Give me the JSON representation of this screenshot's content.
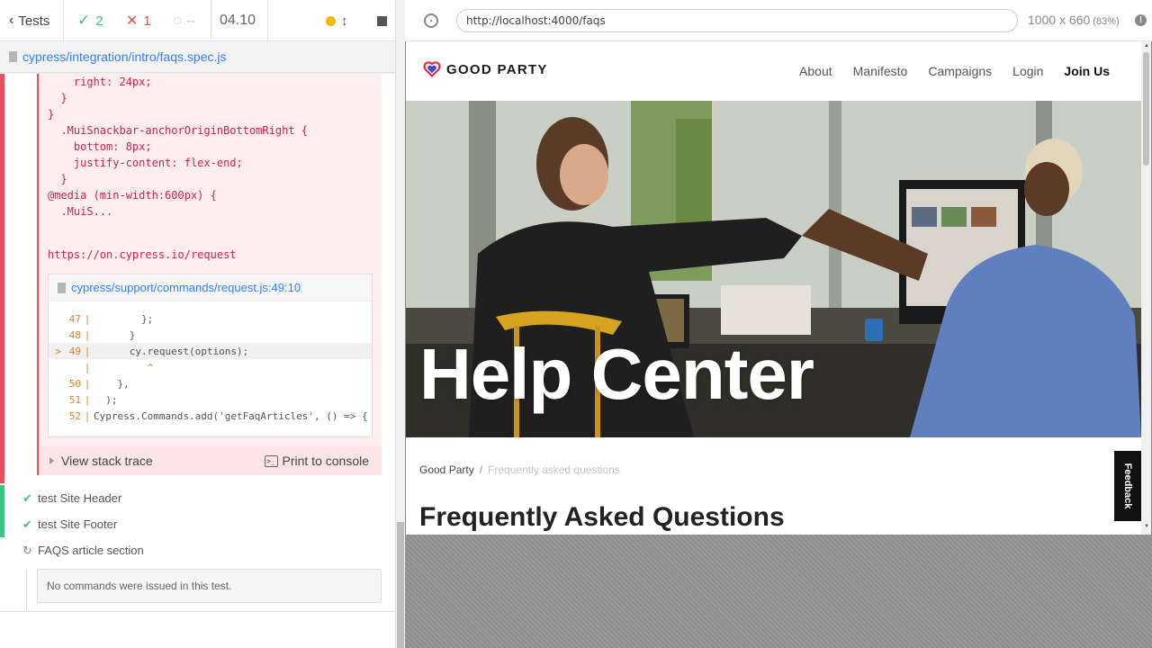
{
  "reporter": {
    "back_label": "Tests",
    "passed": "2",
    "failed": "1",
    "pending": "--",
    "duration": "04.10",
    "spec_path": "cypress/integration/intro/faqs.spec.js",
    "error": {
      "css_snippet": "    right: 24px;\n  }\n}\n  .MuiSnackbar-anchorOriginBottomRight {\n    bottom: 8px;\n    justify-content: flex-end;\n  }\n@media (min-width:600px) {\n  .MuiS...",
      "link": "https://on.cypress.io/request",
      "frame_file": "cypress/support/commands/request.js:49:10",
      "code_lines": [
        {
          "marker": "",
          "num": "47",
          "code": "        };"
        },
        {
          "marker": "",
          "num": "48",
          "code": "      }"
        },
        {
          "marker": ">",
          "num": "49",
          "code": "      cy.request(options);"
        },
        {
          "marker": "",
          "num": "",
          "code": "         ^"
        },
        {
          "marker": "",
          "num": "50",
          "code": "    },"
        },
        {
          "marker": "",
          "num": "51",
          "code": "  );"
        },
        {
          "marker": "",
          "num": "52",
          "code": "Cypress.Commands.add('getFaqArticles', () => {"
        }
      ],
      "view_stack_trace": "View stack trace",
      "print_to_console": "Print to console"
    },
    "tests": [
      {
        "title": "test Site Header",
        "state": "passed"
      },
      {
        "title": "test Site Footer",
        "state": "passed"
      },
      {
        "title": "FAQS article section",
        "state": "running"
      }
    ],
    "no_commands": "No commands were issued in this test."
  },
  "browser": {
    "url": "http://localhost:4000/faqs",
    "viewport": "1000 x 660",
    "scale": "(83%)"
  },
  "site": {
    "brand": "GOOD PARTY",
    "nav": [
      "About",
      "Manifesto",
      "Campaigns",
      "Login",
      "Join Us"
    ],
    "hero_title": "Help Center",
    "breadcrumb_home": "Good Party",
    "breadcrumb_current": "Frequently asked questions",
    "heading": "Frequently Asked Questions",
    "feedback": "Feedback",
    "colors": {
      "accent_red": "#e0213a",
      "accent_blue": "#3a4bd1"
    }
  }
}
